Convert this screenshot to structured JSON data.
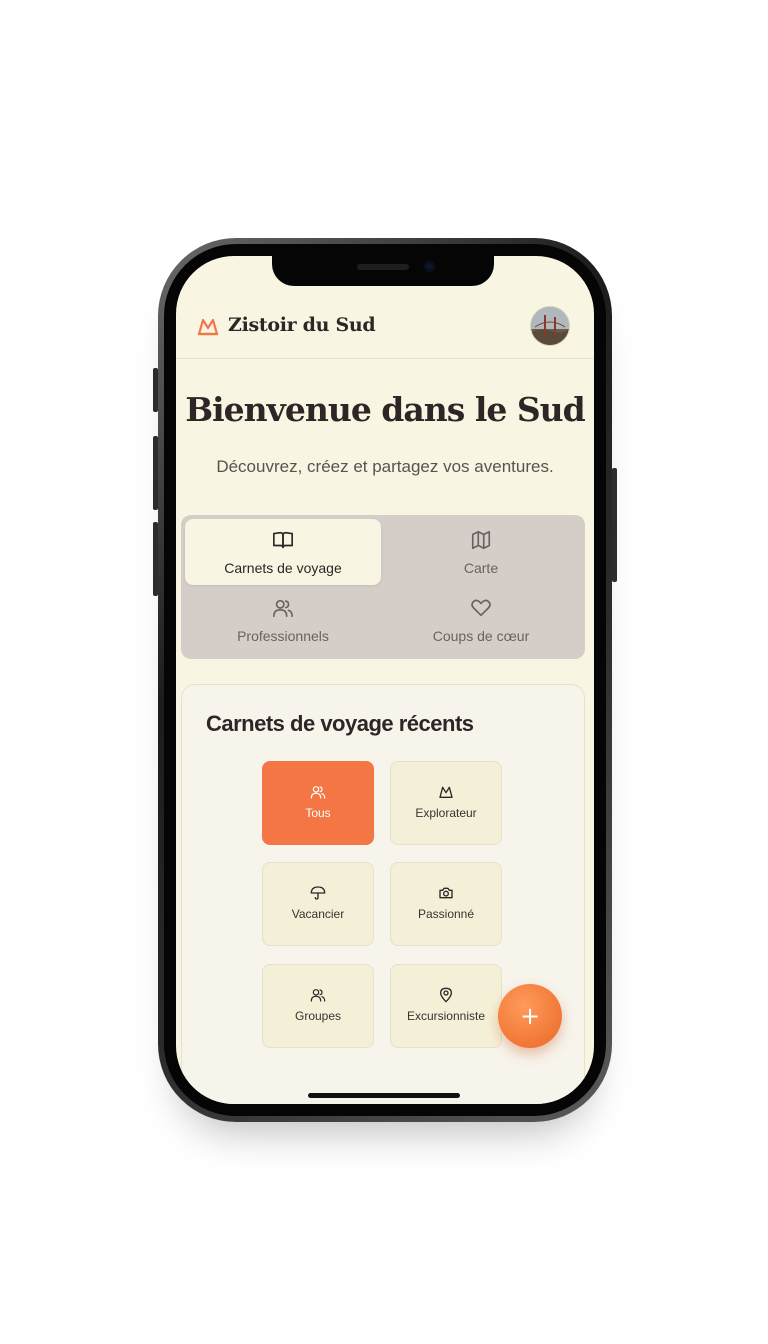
{
  "header": {
    "brand": "Zistoir du Sud",
    "logo_icon": "mountain-logo-icon",
    "avatar": "user-avatar"
  },
  "hero": {
    "title": "Bienvenue dans le Sud",
    "subtitle": "Découvrez, créez et partagez vos aventures."
  },
  "tabs": [
    {
      "label": "Carnets de voyage",
      "icon": "book-open-icon",
      "active": true
    },
    {
      "label": "Carte",
      "icon": "map-icon",
      "active": false
    },
    {
      "label": "Professionnels",
      "icon": "users-icon",
      "active": false
    },
    {
      "label": "Coups de cœur",
      "icon": "heart-icon",
      "active": false
    }
  ],
  "recent": {
    "title": "Carnets de voyage récents",
    "filters": [
      {
        "label": "Tous",
        "icon": "users-icon",
        "active": true
      },
      {
        "label": "Explorateur",
        "icon": "mountain-icon",
        "active": false
      },
      {
        "label": "Vacancier",
        "icon": "umbrella-icon",
        "active": false
      },
      {
        "label": "Passionné",
        "icon": "camera-icon",
        "active": false
      },
      {
        "label": "Groupes",
        "icon": "users-icon",
        "active": false
      },
      {
        "label": "Excursionniste",
        "icon": "map-pin-icon",
        "active": false
      }
    ]
  },
  "fab": {
    "label": "+"
  },
  "colors": {
    "accent": "#f37644",
    "background": "#f8f5e2",
    "tab_bar": "#d4cdc8",
    "text": "#2e2626"
  }
}
